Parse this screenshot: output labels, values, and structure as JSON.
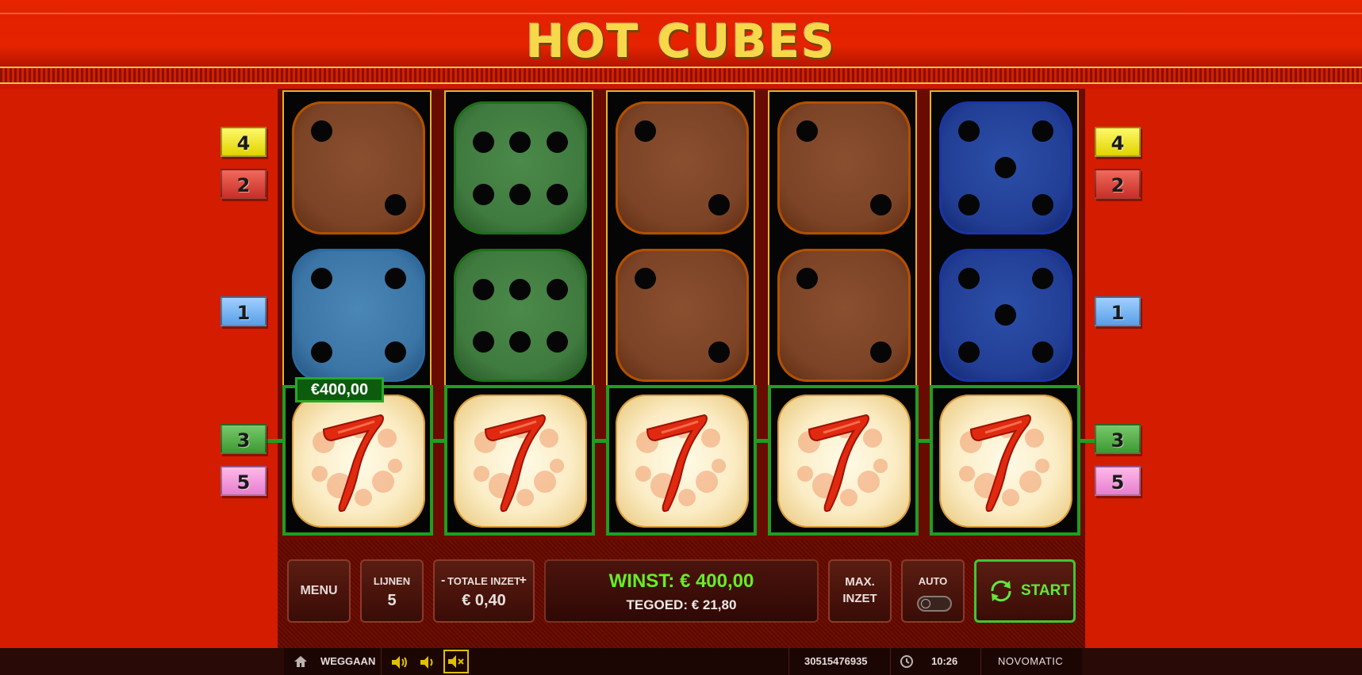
{
  "game": {
    "title": "HOT CUBES",
    "win_badge": "€400,00"
  },
  "markers": {
    "left": [
      "4",
      "2",
      "1",
      "3",
      "5"
    ],
    "right": [
      "4",
      "2",
      "1",
      "3",
      "5"
    ]
  },
  "reels": [
    {
      "top": {
        "color": "brown",
        "value": 2
      },
      "middle": {
        "color": "light-blue",
        "value": 4
      },
      "bottom": "seven"
    },
    {
      "top": {
        "color": "green",
        "value": 6
      },
      "middle": {
        "color": "green",
        "value": 6
      },
      "bottom": "seven"
    },
    {
      "top": {
        "color": "brown",
        "value": 2
      },
      "middle": {
        "color": "brown",
        "value": 2
      },
      "bottom": "seven"
    },
    {
      "top": {
        "color": "brown",
        "value": 2
      },
      "middle": {
        "color": "brown",
        "value": 2
      },
      "bottom": "seven"
    },
    {
      "top": {
        "color": "dark-blue",
        "value": 5
      },
      "middle": {
        "color": "dark-blue",
        "value": 5
      },
      "bottom": "seven"
    }
  ],
  "controls": {
    "menu_label": "MENU",
    "lines_label": "LIJNEN",
    "lines_value": "5",
    "bet_minus": "-",
    "bet_label": "TOTALE INZET",
    "bet_plus": "+",
    "bet_value": "€ 0,40",
    "win_text": "WINST: € 400,00",
    "credit_text": "TEGOED: € 21,80",
    "max_label_1": "MAX.",
    "max_label_2": "INZET",
    "auto_label": "AUTO",
    "start_label": "START"
  },
  "statusbar": {
    "leave_label": "WEGGAAN",
    "session_id": "30515476935",
    "time": "10:26",
    "brand": "NOVOMATIC"
  },
  "colors": {
    "background": "#d91d00",
    "title": "#f7d84a",
    "win_green": "#66ee22",
    "frame_green": "#1f9e1f"
  }
}
